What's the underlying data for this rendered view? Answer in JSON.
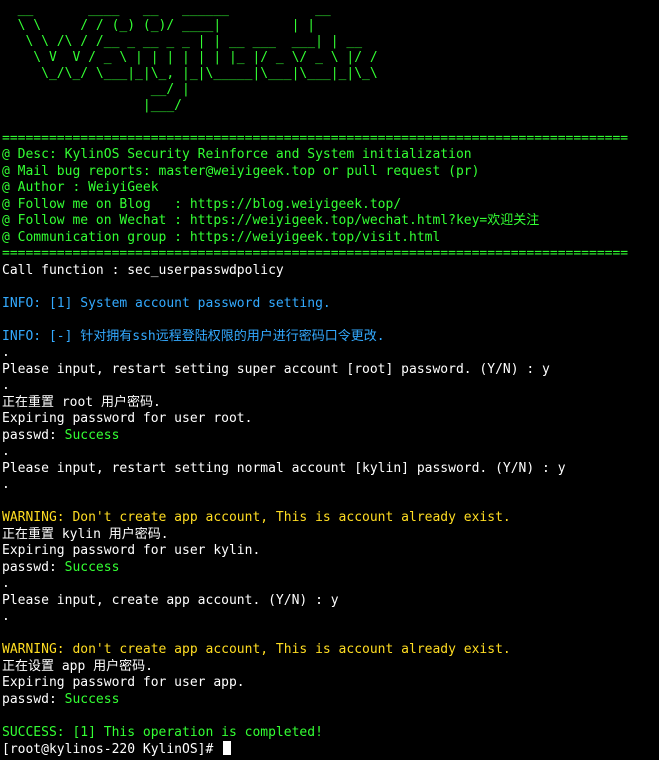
{
  "banner": "  __       ____   __   ______           __\n  \\ \\     / / (_) (_)/ ____|         | |\n   \\ \\ /\\ / /__ _ __ _ _ | | __ ___  ___| | __\n    \\ V  V / _ \\ | | | | | | |_ |/ _ \\/ _ \\ |/ /\n     \\_/\\_/ \\___|_|\\_, |_|\\_____|\\___|\\___|_|\\_\\\n                   __/ |\n                  |___/",
  "separator": "================================================================================",
  "header": {
    "desc": "@ Desc: KylinOS Security Reinforce and System initialization",
    "mail": "@ Mail bug reports: master@weiyigeek.top or pull request (pr)",
    "author": "@ Author : WeiyiGeek",
    "blog": "@ Follow me on Blog   : https://blog.weiyigeek.top/",
    "wechat": "@ Follow me on Wechat : https://weiyigeek.top/wechat.html?key=欢迎关注",
    "group": "@ Communication group : https://weiyigeek.top/visit.html"
  },
  "output": {
    "call_function": "Call function : sec_userpasswdpolicy",
    "info1": "INFO: [1] System account password setting.",
    "info2": "INFO: [-] 针对拥有ssh远程登陆权限的用户进行密码口令更改.",
    "dot": ".",
    "prompt_root": "Please input, restart setting super account [root] password. (Y/N) : y",
    "reset_root": "正在重置 root 用户密码.",
    "expire_root": "Expiring password for user root.",
    "passwd_prefix": "passwd: ",
    "success": "Success",
    "prompt_kylin": "Please input, restart setting normal account [kylin] password. (Y/N) : y",
    "warn_app1": "WARNING: Don't create app account, This is account already exist.",
    "reset_kylin": "正在重置 kylin 用户密码.",
    "expire_kylin": "Expiring password for user kylin.",
    "prompt_app": "Please input, create app account. (Y/N) : y",
    "warn_app2": "WARNING: don't create app account, This is account already exist.",
    "set_app": "正在设置 app 用户密码.",
    "expire_app": "Expiring password for user app.",
    "success_msg": "SUCCESS: [1] This operation is completed!",
    "shell_prompt": "[root@kylinos-220 KylinOS]# "
  },
  "colors": {
    "background": "#000000",
    "green": "#33ff33",
    "blue": "#33aaff",
    "yellow": "#ffdd22",
    "white": "#ffffff"
  }
}
